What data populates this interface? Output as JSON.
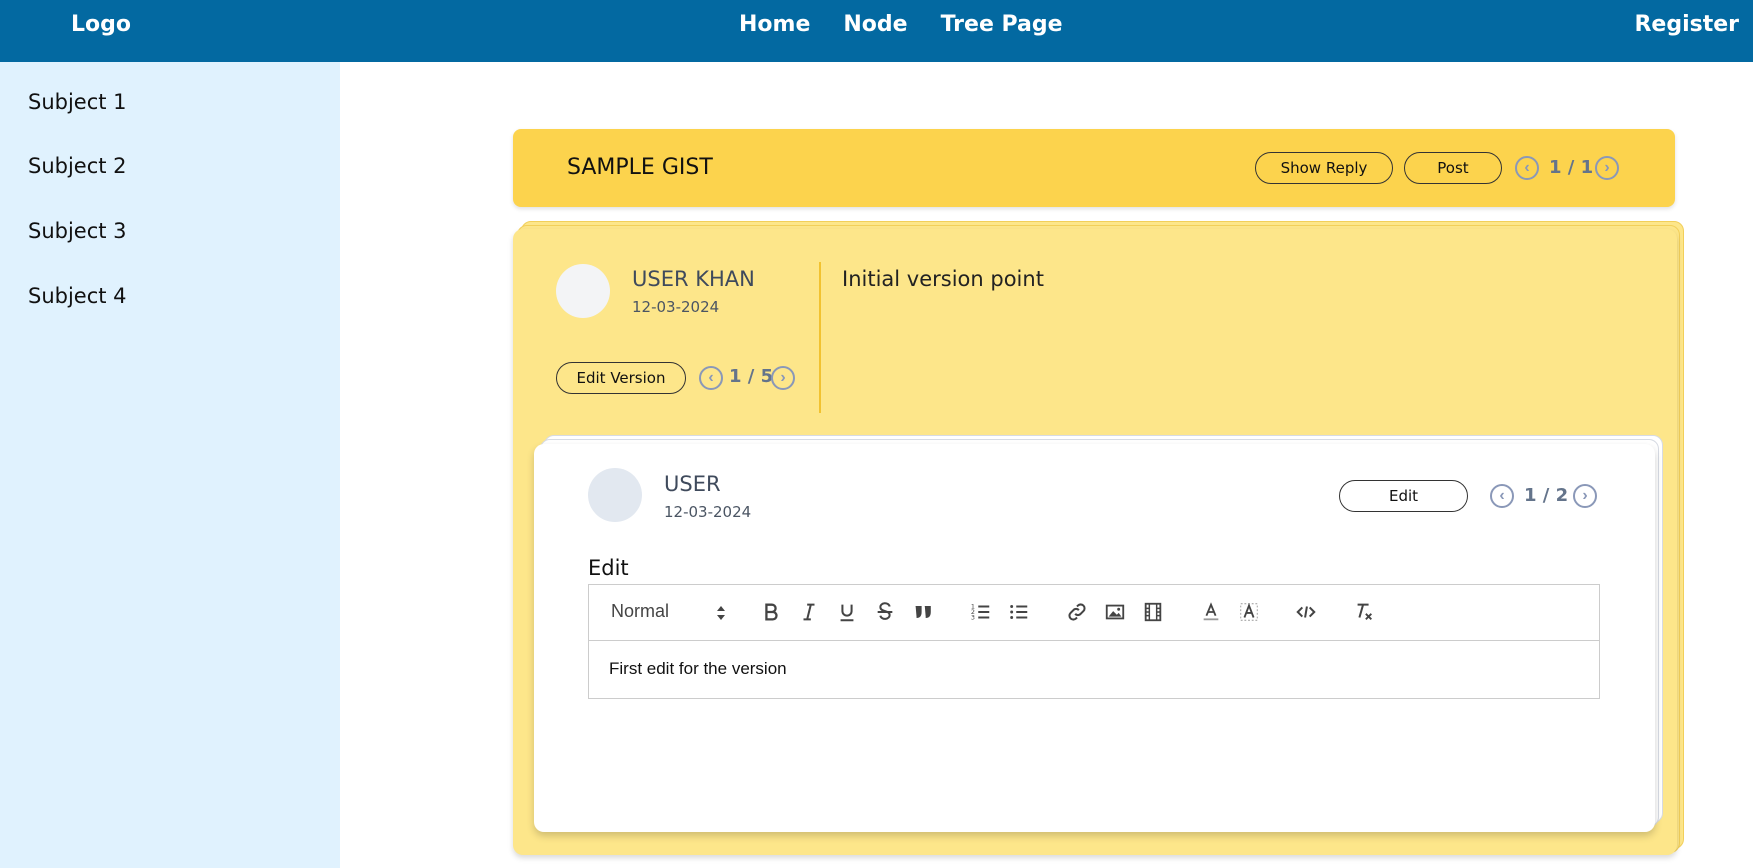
{
  "nav": {
    "logo": "Logo",
    "links": [
      "Home",
      "Node",
      "Tree Page"
    ],
    "register": "Register"
  },
  "sidebar": {
    "items": [
      {
        "label": "Subject 1"
      },
      {
        "label": "Subject 2"
      },
      {
        "label": "Subject 3"
      },
      {
        "label": "Subject 4"
      }
    ]
  },
  "gist": {
    "title": "SAMPLE GIST",
    "show_reply_label": "Show Reply",
    "post_label": "Post",
    "pager": "1 / 1"
  },
  "version": {
    "user": "USER KHAN",
    "date": "12-03-2024",
    "edit_version_label": "Edit Version",
    "pager": "1 / 5",
    "text": "Initial version point"
  },
  "edit": {
    "user": "USER",
    "date": "12-03-2024",
    "edit_label": "Edit",
    "pager": "1 / 2",
    "section_label": "Edit",
    "format_select": "Normal",
    "content": "First edit for the version"
  },
  "colors": {
    "topbar": "#0369a1",
    "sidebar": "#e0f2fe",
    "gist": "#fcd34d",
    "version_card": "#fde68a"
  }
}
